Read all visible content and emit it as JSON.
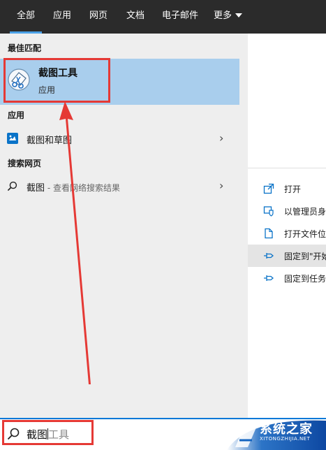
{
  "tabs": [
    {
      "label": "全部",
      "active": true
    },
    {
      "label": "应用"
    },
    {
      "label": "网页"
    },
    {
      "label": "文档"
    },
    {
      "label": "电子邮件"
    },
    {
      "label": "更多"
    }
  ],
  "sections": {
    "best_match": "最佳匹配",
    "apps": "应用",
    "web": "搜索网页"
  },
  "best_match_item": {
    "title": "截图工具",
    "subtitle": "应用",
    "icon": "snipping-tool-icon"
  },
  "app_item": {
    "label": "截图和草图",
    "icon": "snip-sketch-icon"
  },
  "web_item": {
    "query": "截图",
    "hint": " - 查看网络搜索结果",
    "icon": "search-icon"
  },
  "actions": [
    {
      "label": "打开",
      "icon": "open-icon"
    },
    {
      "label": "以管理员身",
      "icon": "shield-icon"
    },
    {
      "label": "打开文件位",
      "icon": "file-location-icon"
    },
    {
      "label": "固定到\"开始",
      "icon": "pin-icon"
    },
    {
      "label": "固定到任务",
      "icon": "pin-icon"
    }
  ],
  "search": {
    "typed": "截图",
    "suggestion": "工具"
  },
  "watermark": {
    "text": "系统之家",
    "sub": "XITONGZHIJIA.NET"
  },
  "colors": {
    "accent": "#0078d7",
    "selection": "#a9ceed",
    "annotation": "#e53935",
    "topbar": "#2b2b2b"
  }
}
